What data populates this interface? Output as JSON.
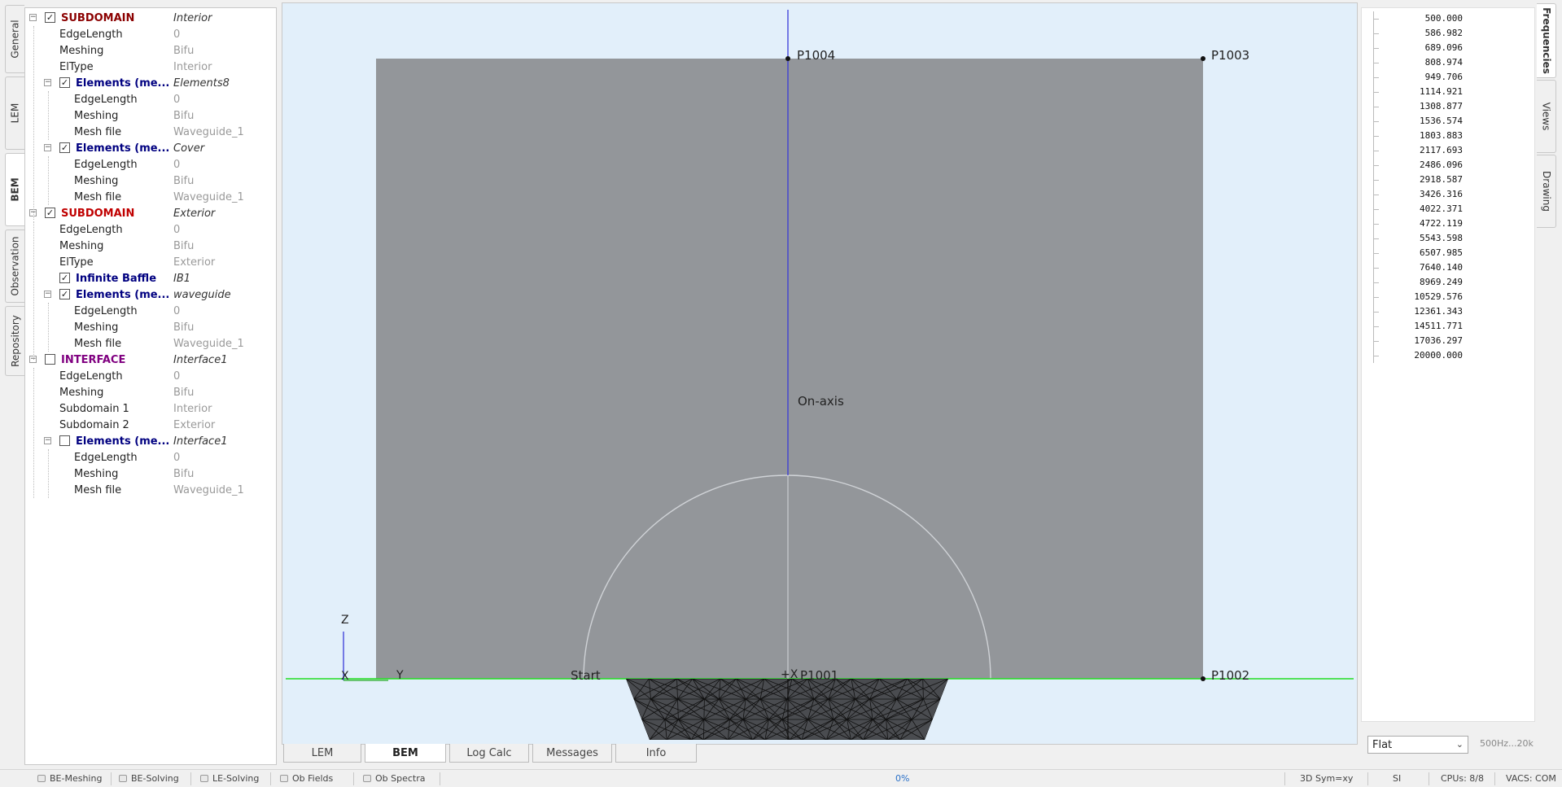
{
  "left_tabs": [
    "General",
    "LEM",
    "BEM",
    "Observation",
    "Repository"
  ],
  "active_left_tab": "BEM",
  "tree": [
    {
      "label": "SUBDOMAIN",
      "value": "Interior",
      "kind": "sub2",
      "level": 0,
      "checked": true,
      "expander": true
    },
    {
      "label": "EdgeLength",
      "value": "0",
      "kind": "prop",
      "level": 1
    },
    {
      "label": "Meshing",
      "value": "Bifu",
      "kind": "prop",
      "level": 1
    },
    {
      "label": "ElType",
      "value": "Interior",
      "kind": "prop",
      "level": 1
    },
    {
      "label": "Elements (me...",
      "value": "Elements8",
      "kind": "el",
      "level": 1,
      "checked": true,
      "expander": true
    },
    {
      "label": "EdgeLength",
      "value": "0",
      "kind": "prop",
      "level": 2
    },
    {
      "label": "Meshing",
      "value": "Bifu",
      "kind": "prop",
      "level": 2
    },
    {
      "label": "Mesh file",
      "value": "Waveguide_1",
      "kind": "prop",
      "level": 2
    },
    {
      "label": "Elements (me...",
      "value": "Cover",
      "kind": "el",
      "level": 1,
      "checked": true,
      "expander": true
    },
    {
      "label": "EdgeLength",
      "value": "0",
      "kind": "prop",
      "level": 2
    },
    {
      "label": "Meshing",
      "value": "Bifu",
      "kind": "prop",
      "level": 2
    },
    {
      "label": "Mesh file",
      "value": "Waveguide_1",
      "kind": "prop",
      "level": 2
    },
    {
      "label": "SUBDOMAIN",
      "value": "Exterior",
      "kind": "sub",
      "level": 0,
      "checked": true,
      "expander": true
    },
    {
      "label": "EdgeLength",
      "value": "0",
      "kind": "prop",
      "level": 1
    },
    {
      "label": "Meshing",
      "value": "Bifu",
      "kind": "prop",
      "level": 1
    },
    {
      "label": "ElType",
      "value": "Exterior",
      "kind": "prop",
      "level": 1
    },
    {
      "label": "Infinite Baffle",
      "value": "IB1",
      "kind": "el",
      "level": 1,
      "checked": true,
      "expander": false
    },
    {
      "label": "Elements (me...",
      "value": "waveguide",
      "kind": "el",
      "level": 1,
      "checked": true,
      "expander": true
    },
    {
      "label": "EdgeLength",
      "value": "0",
      "kind": "prop",
      "level": 2
    },
    {
      "label": "Meshing",
      "value": "Bifu",
      "kind": "prop",
      "level": 2
    },
    {
      "label": "Mesh file",
      "value": "Waveguide_1",
      "kind": "prop",
      "level": 2
    },
    {
      "label": "INTERFACE",
      "value": "Interface1",
      "kind": "iface",
      "level": 0,
      "checked": false,
      "expander": true
    },
    {
      "label": "EdgeLength",
      "value": "0",
      "kind": "prop",
      "level": 1
    },
    {
      "label": "Meshing",
      "value": "Bifu",
      "kind": "prop",
      "level": 1
    },
    {
      "label": "Subdomain 1",
      "value": "Interior",
      "kind": "prop",
      "level": 1
    },
    {
      "label": "Subdomain 2",
      "value": "Exterior",
      "kind": "prop",
      "level": 1
    },
    {
      "label": "Elements (me...",
      "value": "Interface1",
      "kind": "el",
      "level": 1,
      "checked": false,
      "expander": true
    },
    {
      "label": "EdgeLength",
      "value": "0",
      "kind": "prop",
      "level": 2
    },
    {
      "label": "Meshing",
      "value": "Bifu",
      "kind": "prop",
      "level": 2
    },
    {
      "label": "Mesh file",
      "value": "Waveguide_1",
      "kind": "prop",
      "level": 2
    }
  ],
  "viewport": {
    "points": {
      "p1004": "P1004",
      "p1003": "P1003",
      "p1002": "P1002",
      "p1001": "P1001"
    },
    "on_axis": "On-axis",
    "start": "Start",
    "axis_z": "Z",
    "axis_y": "Y",
    "axis_x": "X",
    "origin_marker": "+X",
    "colors": {
      "background": "#e2effa",
      "baffle": "#93969a",
      "axis_blue": "#3a3ad8",
      "ground_green": "#22dd22",
      "mesh": "#1a1a1a"
    }
  },
  "bottom_tabs": [
    "LEM",
    "BEM",
    "Log Calc",
    "Messages",
    "Info"
  ],
  "active_bottom_tab": "BEM",
  "frequencies": [
    "500.000",
    "586.982",
    "689.096",
    "808.974",
    "949.706",
    "1114.921",
    "1308.877",
    "1536.574",
    "1803.883",
    "2117.693",
    "2486.096",
    "2918.587",
    "3426.316",
    "4022.371",
    "4722.119",
    "5543.598",
    "6507.985",
    "7640.140",
    "8969.249",
    "10529.576",
    "12361.343",
    "14511.771",
    "17036.297",
    "20000.000"
  ],
  "right_tabs": [
    "Frequencies",
    "Views",
    "Drawing"
  ],
  "active_right_tab": "Frequencies",
  "flat_select": {
    "value": "Flat",
    "arrow": "⌄"
  },
  "freq_range": "500Hz...20k",
  "statusbar": {
    "items": [
      "BE-Meshing",
      "BE-Solving",
      "LE-Solving",
      "Ob Fields",
      "Ob Spectra"
    ],
    "progress": "0%",
    "sym": "3D Sym=xy",
    "units": "SI",
    "cpus": "CPUs: 8/8",
    "vacs": "VACS: COM"
  }
}
